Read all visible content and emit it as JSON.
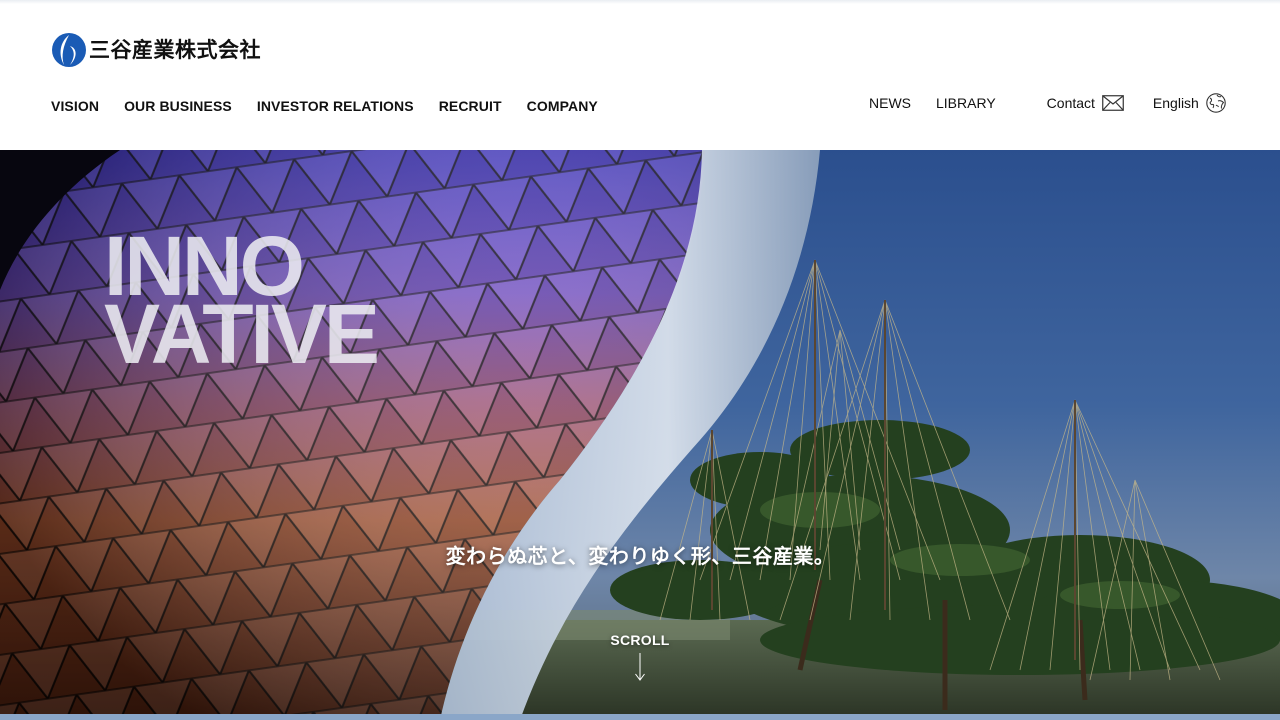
{
  "header": {
    "logo_text": "三谷産業株式会社",
    "logo_color": "#1a5bb5",
    "main_nav": [
      {
        "label": "VISION"
      },
      {
        "label": "OUR BUSINESS"
      },
      {
        "label": "INVESTOR RELATIONS"
      },
      {
        "label": "RECRUIT"
      },
      {
        "label": "COMPANY"
      }
    ],
    "util_nav": {
      "news": "NEWS",
      "library": "LIBRARY",
      "contact": "Contact",
      "english": "English"
    },
    "icons": {
      "contact": "mail-icon",
      "english": "globe-icon"
    }
  },
  "hero": {
    "word_line1": "INNO",
    "word_line2": "VATIVE",
    "tagline": "変わらぬ芯と、変わりゆく形、三谷産業。",
    "scroll_label": "SCROLL",
    "accent_color": "#8aa6c8"
  }
}
